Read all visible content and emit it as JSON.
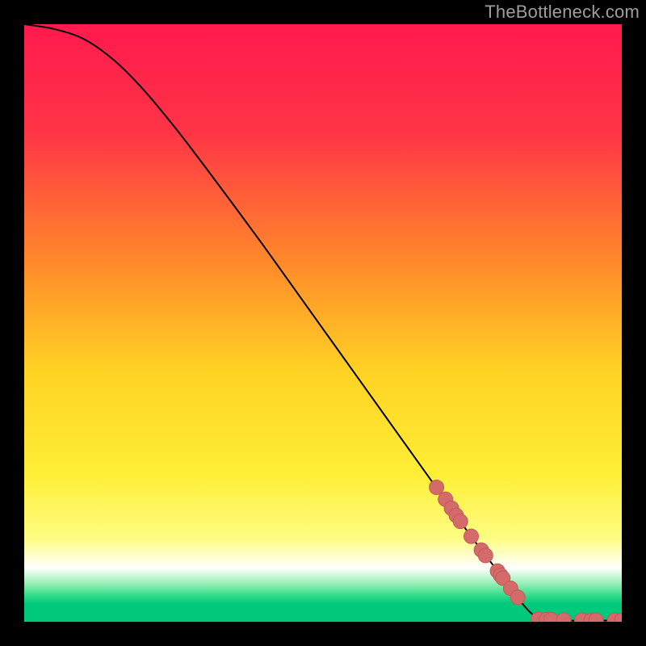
{
  "attribution": "TheBottleneck.com",
  "colors": {
    "background": "#000000",
    "curve": "#000000",
    "markers": "#d56a6a",
    "markers_stroke": "#c05a5a",
    "gradient_stops": [
      {
        "offset": 0.0,
        "color": "#ff1a4e"
      },
      {
        "offset": 0.18,
        "color": "#ff3446"
      },
      {
        "offset": 0.4,
        "color": "#ff8a2a"
      },
      {
        "offset": 0.58,
        "color": "#ffd224"
      },
      {
        "offset": 0.75,
        "color": "#ffee35"
      },
      {
        "offset": 0.86,
        "color": "#fdfd82"
      },
      {
        "offset": 0.91,
        "color": "#ffffff"
      },
      {
        "offset": 0.935,
        "color": "#9cf0b8"
      },
      {
        "offset": 0.955,
        "color": "#36dd8a"
      },
      {
        "offset": 0.97,
        "color": "#00c97b"
      },
      {
        "offset": 1.0,
        "color": "#00c97b"
      }
    ]
  },
  "chart_data": {
    "type": "line",
    "title": "",
    "xlabel": "",
    "ylabel": "",
    "xlim": [
      0,
      100
    ],
    "ylim": [
      0,
      100
    ],
    "curve": [
      {
        "x": 0,
        "y": 100
      },
      {
        "x": 5,
        "y": 99.2
      },
      {
        "x": 10,
        "y": 97.5
      },
      {
        "x": 15,
        "y": 94.0
      },
      {
        "x": 20,
        "y": 89.0
      },
      {
        "x": 25,
        "y": 83.0
      },
      {
        "x": 30,
        "y": 76.5
      },
      {
        "x": 35,
        "y": 69.8
      },
      {
        "x": 40,
        "y": 63.0
      },
      {
        "x": 45,
        "y": 56.0
      },
      {
        "x": 50,
        "y": 49.0
      },
      {
        "x": 55,
        "y": 42.0
      },
      {
        "x": 60,
        "y": 35.0
      },
      {
        "x": 65,
        "y": 28.0
      },
      {
        "x": 70,
        "y": 21.0
      },
      {
        "x": 75,
        "y": 14.0
      },
      {
        "x": 80,
        "y": 7.5
      },
      {
        "x": 83,
        "y": 3.5
      },
      {
        "x": 85,
        "y": 1.3
      },
      {
        "x": 87,
        "y": 0.4
      },
      {
        "x": 90,
        "y": 0.2
      },
      {
        "x": 95,
        "y": 0.2
      },
      {
        "x": 100,
        "y": 0.2
      }
    ],
    "markers_on_curve": [
      {
        "x": 69.0,
        "y": 22.5
      },
      {
        "x": 70.5,
        "y": 20.5
      },
      {
        "x": 71.5,
        "y": 19.0
      },
      {
        "x": 72.3,
        "y": 17.8
      },
      {
        "x": 73.0,
        "y": 16.8
      },
      {
        "x": 74.8,
        "y": 14.3
      },
      {
        "x": 76.5,
        "y": 12.0
      },
      {
        "x": 77.2,
        "y": 11.1
      },
      {
        "x": 79.2,
        "y": 8.5
      },
      {
        "x": 79.7,
        "y": 7.8
      },
      {
        "x": 80.1,
        "y": 7.3
      },
      {
        "x": 81.4,
        "y": 5.6
      },
      {
        "x": 82.6,
        "y": 4.1
      }
    ],
    "markers_bottom": [
      {
        "x": 86.0,
        "y": 0.4
      },
      {
        "x": 87.4,
        "y": 0.35
      },
      {
        "x": 88.2,
        "y": 0.33
      },
      {
        "x": 90.3,
        "y": 0.3
      },
      {
        "x": 93.3,
        "y": 0.28
      },
      {
        "x": 94.9,
        "y": 0.27
      },
      {
        "x": 95.7,
        "y": 0.27
      },
      {
        "x": 98.8,
        "y": 0.26
      },
      {
        "x": 100.0,
        "y": 0.26
      }
    ]
  }
}
